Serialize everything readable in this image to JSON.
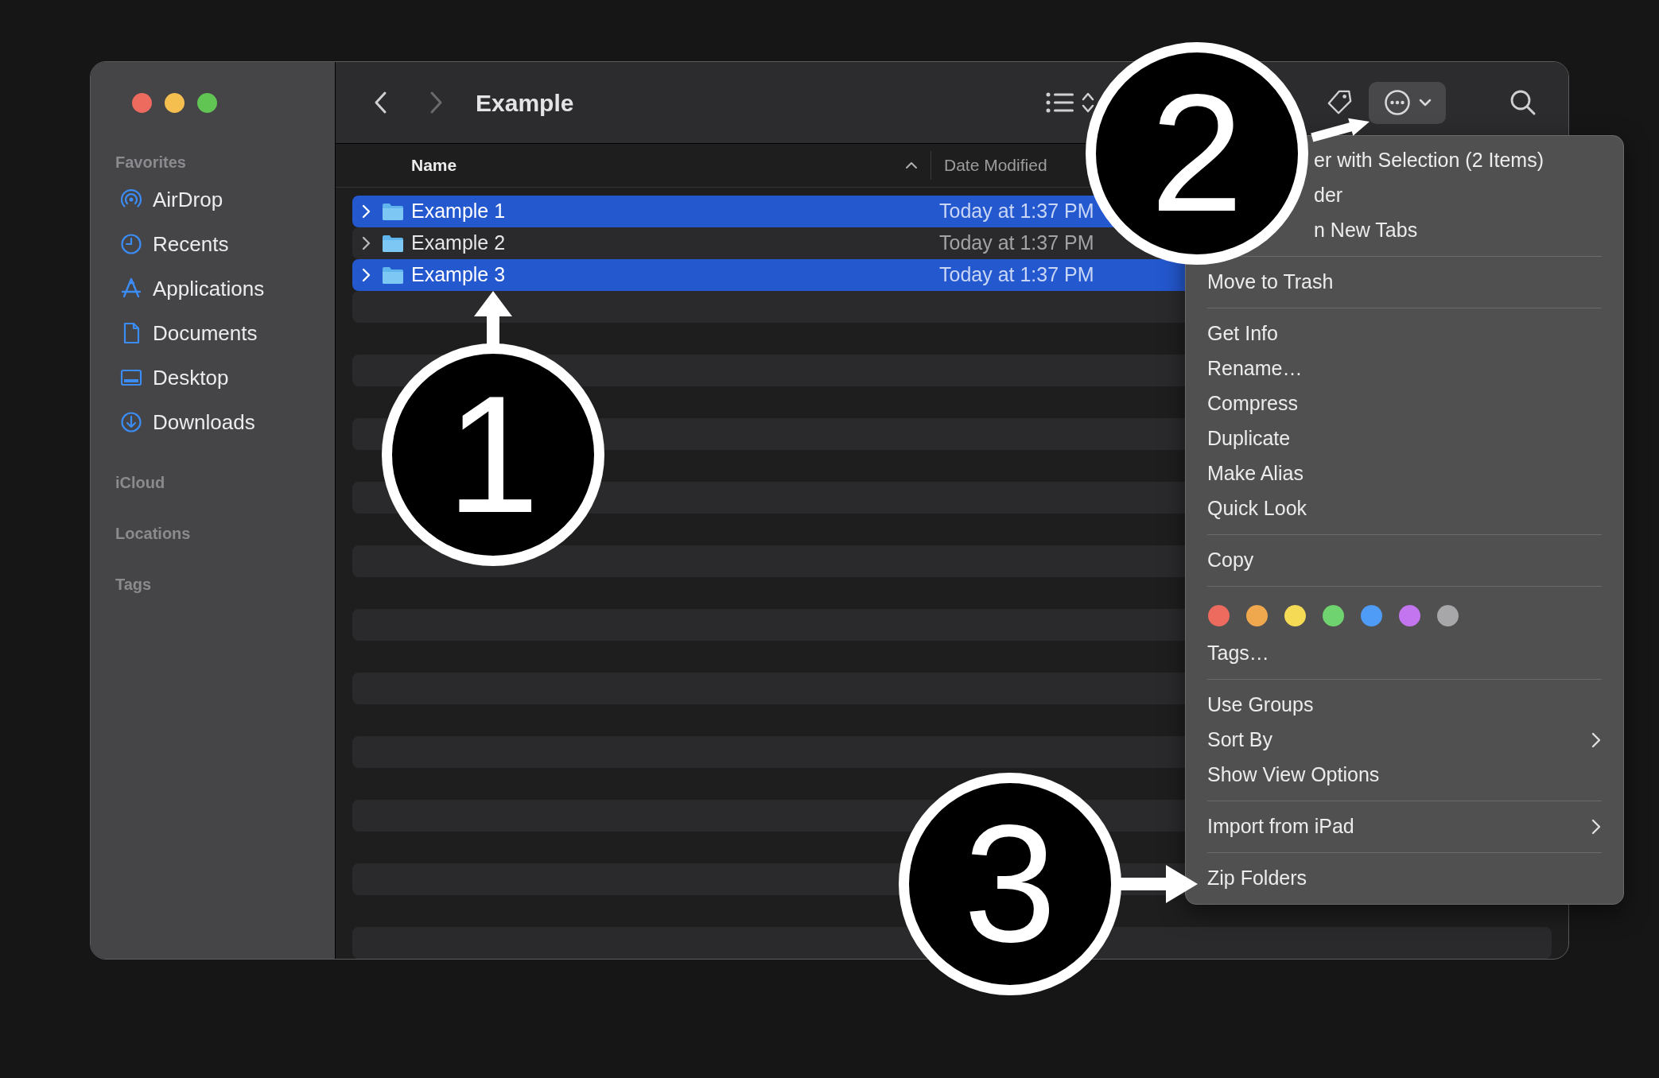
{
  "window": {
    "title": "Example"
  },
  "sidebar": {
    "sections": [
      {
        "heading": "Favorites",
        "items": [
          {
            "label": "AirDrop"
          },
          {
            "label": "Recents"
          },
          {
            "label": "Applications"
          },
          {
            "label": "Documents"
          },
          {
            "label": "Desktop"
          },
          {
            "label": "Downloads"
          }
        ]
      },
      {
        "heading": "iCloud"
      },
      {
        "heading": "Locations"
      },
      {
        "heading": "Tags"
      }
    ]
  },
  "table": {
    "columns": [
      {
        "label": "Name",
        "sorted": true
      },
      {
        "label": "Date Modified",
        "sorted": false
      }
    ],
    "rows": [
      {
        "name": "Example 1",
        "date": "Today at 1:37 PM",
        "selected": true
      },
      {
        "name": "Example 2",
        "date": "Today at 1:37 PM",
        "selected": false
      },
      {
        "name": "Example 3",
        "date": "Today at 1:37 PM",
        "selected": true
      }
    ]
  },
  "context_menu": {
    "items": [
      {
        "kind": "item",
        "label": "er with Selection (2 Items)",
        "covered": true,
        "submenu": false
      },
      {
        "kind": "item",
        "label": "der",
        "covered": true,
        "submenu": false
      },
      {
        "kind": "item",
        "label": "n New Tabs",
        "covered": true,
        "submenu": false
      },
      {
        "kind": "separator"
      },
      {
        "kind": "item",
        "label": "Move to Trash",
        "covered": false,
        "submenu": false
      },
      {
        "kind": "separator"
      },
      {
        "kind": "item",
        "label": "Get Info",
        "covered": false,
        "submenu": false
      },
      {
        "kind": "item",
        "label": "Rename…",
        "covered": false,
        "submenu": false
      },
      {
        "kind": "item",
        "label": "Compress",
        "covered": false,
        "submenu": false
      },
      {
        "kind": "item",
        "label": "Duplicate",
        "covered": false,
        "submenu": false
      },
      {
        "kind": "item",
        "label": "Make Alias",
        "covered": false,
        "submenu": false
      },
      {
        "kind": "item",
        "label": "Quick Look",
        "covered": false,
        "submenu": false
      },
      {
        "kind": "separator"
      },
      {
        "kind": "item",
        "label": "Copy",
        "covered": false,
        "submenu": false
      },
      {
        "kind": "separator"
      },
      {
        "kind": "tag_colors",
        "tags": [
          {
            "color": "#ec6a5e"
          },
          {
            "color": "#f0a84f"
          },
          {
            "color": "#f5da55"
          },
          {
            "color": "#6fd36f"
          },
          {
            "color": "#4f9cf6"
          },
          {
            "color": "#c275ee"
          },
          {
            "color": "#a7a7a9"
          }
        ]
      },
      {
        "kind": "item",
        "label": "Tags…",
        "covered": false,
        "submenu": false
      },
      {
        "kind": "separator"
      },
      {
        "kind": "item",
        "label": "Use Groups",
        "covered": false,
        "submenu": false
      },
      {
        "kind": "item",
        "label": "Sort By",
        "covered": false,
        "submenu": true
      },
      {
        "kind": "item",
        "label": "Show View Options",
        "covered": false,
        "submenu": false
      },
      {
        "kind": "separator"
      },
      {
        "kind": "item",
        "label": "Import from iPad",
        "covered": false,
        "submenu": true
      },
      {
        "kind": "separator"
      },
      {
        "kind": "item",
        "label": "Zip Folders",
        "covered": false,
        "submenu": false
      }
    ]
  },
  "callouts": [
    {
      "number": "1"
    },
    {
      "number": "2"
    },
    {
      "number": "3"
    }
  ]
}
